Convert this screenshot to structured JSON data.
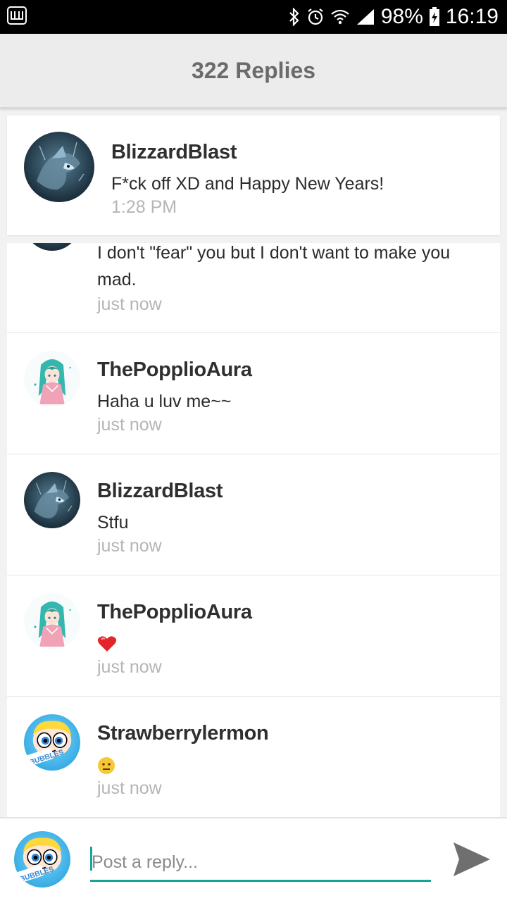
{
  "status_bar": {
    "battery": "98%",
    "time": "16:19"
  },
  "app_bar": {
    "title": "322 Replies"
  },
  "parent_comment": {
    "author": "BlizzardBlast",
    "text": "F*ck off XD and Happy New Years!",
    "time": "1:28 PM",
    "avatar": "blizzard-avatar"
  },
  "replies": [
    {
      "author": "",
      "text": "I don't \"fear\" you but I don't want to make you mad.",
      "time": "just now",
      "avatar": "blizzard-avatar"
    },
    {
      "author": "ThePopplioAura",
      "text": "Haha u luv me~~",
      "time": "just now",
      "avatar": "anime-girl-avatar"
    },
    {
      "author": "BlizzardBlast",
      "text": "Stfu",
      "time": "just now",
      "avatar": "blizzard-avatar"
    },
    {
      "author": "ThePopplioAura",
      "text": "",
      "emoji": "heart",
      "time": "just now",
      "avatar": "anime-girl-avatar"
    },
    {
      "author": "Strawberrylermon",
      "text": "",
      "emoji": "neutral-face",
      "time": "just now",
      "avatar": "bubbles-avatar"
    }
  ],
  "composer": {
    "placeholder": "Post a reply...",
    "avatar": "bubbles-avatar"
  },
  "colors": {
    "accent": "#17a39a",
    "app_bar": "#ececec",
    "status_bar": "#000000"
  }
}
